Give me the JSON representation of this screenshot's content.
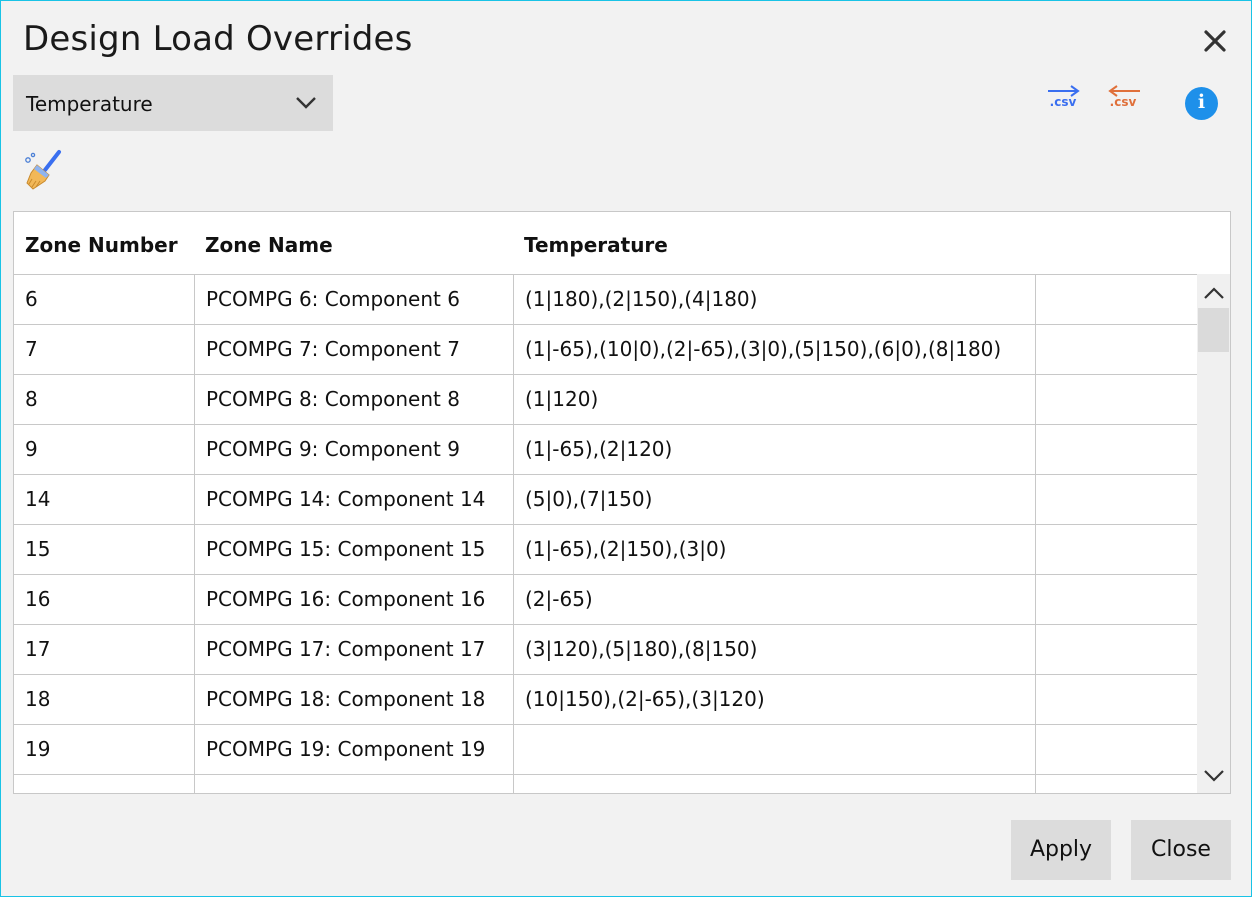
{
  "dialog": {
    "title": "Design Load Overrides",
    "close_icon": "close-icon"
  },
  "toolbar": {
    "load_type_selected": "Temperature",
    "export_csv_label": ".csv",
    "import_csv_label": ".csv",
    "info_label": "i",
    "export_color": "#3a6ff0",
    "import_color": "#e0703a",
    "info_color": "#1e90ea"
  },
  "table": {
    "headers": [
      "Zone Number",
      "Zone Name",
      "Temperature"
    ],
    "rows": [
      {
        "zone_number": "6",
        "zone_name": "PCOMPG 6: Component 6",
        "temperature": "(1|180),(2|150),(4|180)"
      },
      {
        "zone_number": "7",
        "zone_name": "PCOMPG 7: Component 7",
        "temperature": "(1|-65),(10|0),(2|-65),(3|0),(5|150),(6|0),(8|180)"
      },
      {
        "zone_number": "8",
        "zone_name": "PCOMPG 8: Component 8",
        "temperature": "(1|120)"
      },
      {
        "zone_number": "9",
        "zone_name": "PCOMPG 9: Component 9",
        "temperature": "(1|-65),(2|120)"
      },
      {
        "zone_number": "14",
        "zone_name": "PCOMPG 14: Component 14",
        "temperature": "(5|0),(7|150)"
      },
      {
        "zone_number": "15",
        "zone_name": "PCOMPG 15: Component 15",
        "temperature": "(1|-65),(2|150),(3|0)"
      },
      {
        "zone_number": "16",
        "zone_name": "PCOMPG 16: Component 16",
        "temperature": "(2|-65)"
      },
      {
        "zone_number": "17",
        "zone_name": "PCOMPG 17: Component 17",
        "temperature": "(3|120),(5|180),(8|150)"
      },
      {
        "zone_number": "18",
        "zone_name": "PCOMPG 18: Component 18",
        "temperature": "(10|150),(2|-65),(3|120)"
      },
      {
        "zone_number": "19",
        "zone_name": "PCOMPG 19: Component 19",
        "temperature": ""
      },
      {
        "zone_number": "",
        "zone_name": "",
        "temperature": ""
      }
    ]
  },
  "footer": {
    "apply_label": "Apply",
    "close_label": "Close"
  }
}
